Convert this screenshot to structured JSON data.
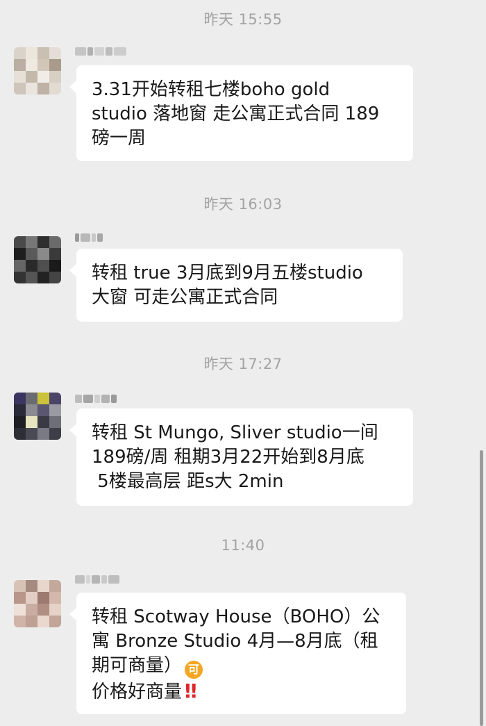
{
  "messages": [
    {
      "timestamp": "昨天 15:55",
      "lines": [
        "3.31开始转租七楼boho gold",
        "studio 落地窗 走公寓正式合同 189",
        "磅一周"
      ]
    },
    {
      "timestamp": "昨天 16:03",
      "lines": [
        "转租 true 3月底到9月五楼studio",
        "大窗 可走公寓正式合同"
      ]
    },
    {
      "timestamp": "昨天 17:27",
      "lines": [
        "转租 St Mungo, Sliver studio一间",
        "189磅/周 租期3月22开始到8月底",
        " 5楼最高层 距s大 2min"
      ]
    },
    {
      "timestamp": "11:40",
      "lines": [
        "转租 Scotway House（BOHO）公",
        "寓 Bronze Studio 4月—8月底（租",
        "期可商量）",
        "价格好商量"
      ],
      "emoji_1": "可",
      "emoji_2": "‼"
    }
  ],
  "icons": {
    "emoji_1": "ke-emoji-icon",
    "emoji_2": "double-exclamation-icon"
  },
  "colors": {
    "background": "#ededed",
    "bubble": "#ffffff",
    "timestamp_text": "#a3a3a3",
    "message_text": "#191919",
    "emoji_orange": "#f5a623",
    "emoji_red": "#e0262a"
  }
}
